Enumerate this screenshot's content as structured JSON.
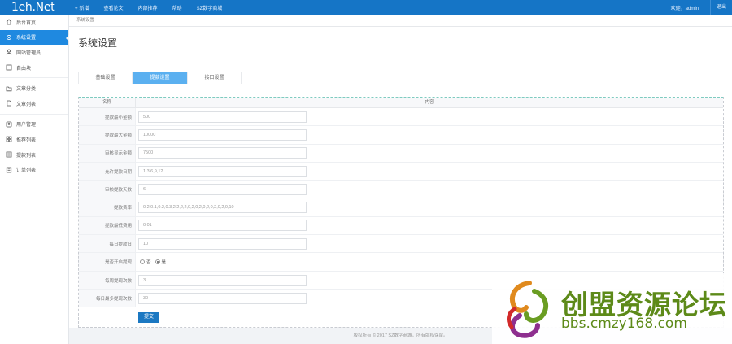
{
  "header": {
    "logo": "1eh.Net",
    "nav": [
      {
        "label": "新增",
        "plus": true
      },
      {
        "label": "查看论文"
      },
      {
        "label": "内部推荐"
      },
      {
        "label": "帮助"
      },
      {
        "label": "SZ数字商城"
      }
    ],
    "user": "欢迎，admin",
    "logout": "退出"
  },
  "sidebar": {
    "items": [
      {
        "label": "后台首页",
        "icon": "home-icon"
      },
      {
        "label": "系统设置",
        "icon": "gear-icon",
        "active": true
      },
      {
        "label": "网站管理员",
        "icon": "user-icon"
      },
      {
        "label": "自由块",
        "icon": "block-icon"
      },
      {
        "label": "文章分类",
        "icon": "folder-icon"
      },
      {
        "label": "文章列表",
        "icon": "document-icon"
      },
      {
        "label": "用户管理",
        "icon": "users-icon"
      },
      {
        "label": "推荐列表",
        "icon": "grid-icon"
      },
      {
        "label": "提款列表",
        "icon": "list-icon"
      },
      {
        "label": "订单列表",
        "icon": "order-icon"
      }
    ]
  },
  "breadcrumb": "系统设置",
  "page_title": "系统设置",
  "tabs": [
    {
      "label": "基础设置"
    },
    {
      "label": "提款设置",
      "active": true
    },
    {
      "label": "接口设置"
    }
  ],
  "table": {
    "col_name": "名称",
    "col_content": "内容",
    "rows": [
      {
        "label": "提款最小金额",
        "type": "text",
        "value": "500"
      },
      {
        "label": "提款最大金额",
        "type": "text",
        "value": "10000"
      },
      {
        "label": "审核显示金额",
        "type": "text",
        "value": "7500"
      },
      {
        "label": "允许提款日期",
        "type": "text",
        "value": "1,3,6,9,12"
      },
      {
        "label": "审核提款天数",
        "type": "text",
        "value": "6"
      },
      {
        "label": "提款费率",
        "type": "text",
        "value": "0.2,0.1,0.2,0.3,2,2,2,2,0,2,0,2,0,2,0,2,0,2,0,10"
      },
      {
        "label": "提款最低费用",
        "type": "text",
        "value": "0.01"
      },
      {
        "label": "每日提款日",
        "type": "text",
        "value": "10"
      },
      {
        "label": "是否开启提现",
        "type": "radio",
        "options": [
          "否",
          "是"
        ],
        "selected": "是"
      },
      {
        "label": "每周提现次数",
        "type": "text",
        "value": "3"
      },
      {
        "label": "每日最多提现次数",
        "type": "text",
        "value": "30"
      }
    ],
    "submit_label": "提交"
  },
  "footer": "版权所有 © 2017 SZ数字商城，所有版权保留。",
  "watermark": {
    "title": "创盟资源论坛",
    "url": "bbs.cmzy168.com"
  }
}
